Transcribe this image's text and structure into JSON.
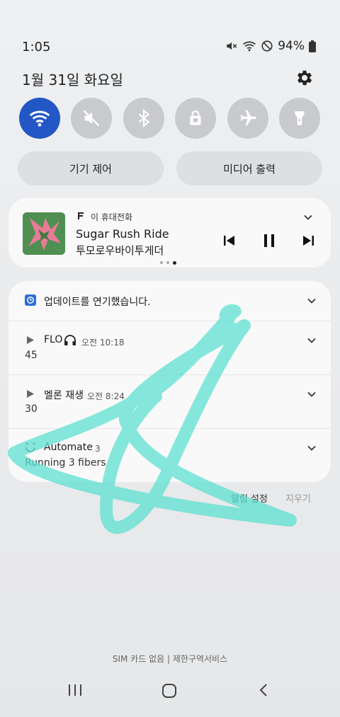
{
  "status_bar": {
    "time": "1:05",
    "battery": "94%"
  },
  "header": {
    "date": "1월 31일 화요일"
  },
  "quick_panel": {
    "toggles": [
      {
        "name": "wifi",
        "icon": "wifi-icon",
        "on": true
      },
      {
        "name": "sound",
        "icon": "mute-icon",
        "on": false
      },
      {
        "name": "bluetooth",
        "icon": "bluetooth-icon",
        "on": false
      },
      {
        "name": "lock",
        "icon": "lock-icon",
        "on": false
      },
      {
        "name": "airplane",
        "icon": "airplane-icon",
        "on": false
      },
      {
        "name": "flashlight",
        "icon": "flashlight-icon",
        "on": false
      }
    ],
    "device_control_label": "기기 제어",
    "media_output_label": "미디어 출력"
  },
  "media": {
    "source_label": "이 휴대전화",
    "title": "Sugar Rush Ride",
    "artist": "투모로우바이투게더"
  },
  "notifications": {
    "update": {
      "text": "업데이트를 연기했습니다."
    },
    "flo": {
      "app": "FLO",
      "time": "오전 10:18",
      "body": "45"
    },
    "melon": {
      "app": "멜론 재생",
      "time": "오전 8:24",
      "body": "30"
    },
    "automate": {
      "app": "Automate",
      "count": "3",
      "body": "Running 3 fibers"
    }
  },
  "footer": {
    "notification_settings": "알림 설정",
    "clear": "지우기",
    "carrier": "SIM 카드 없음 | 제한구역서비스"
  },
  "colors": {
    "accent": "#2357c5",
    "scribble": "#5ee0d0"
  }
}
